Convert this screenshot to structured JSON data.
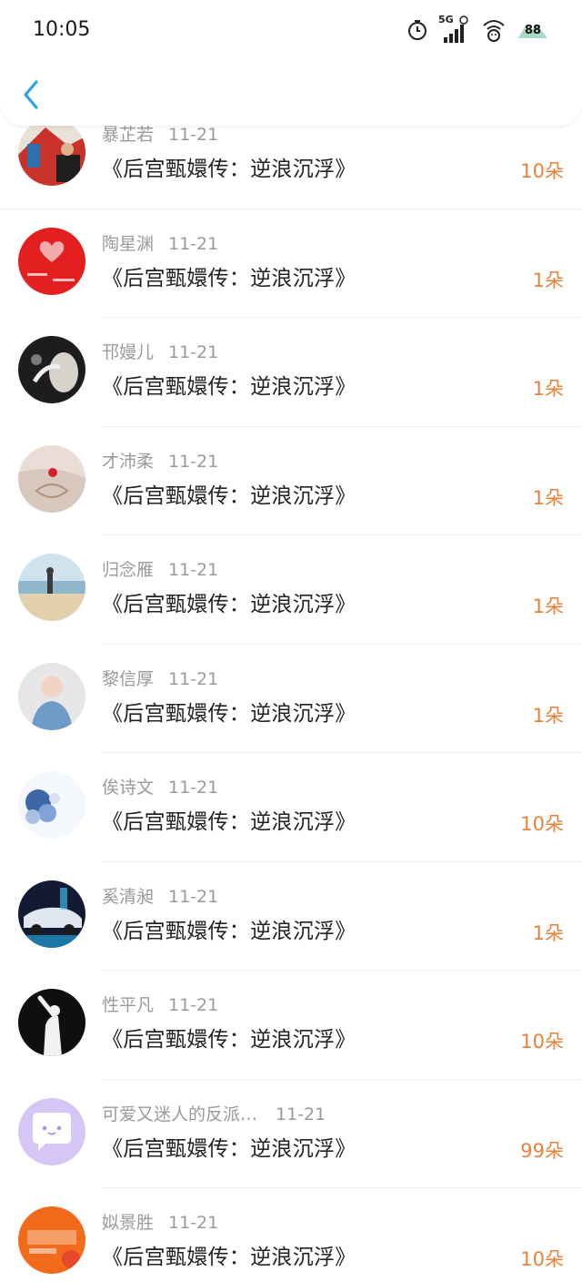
{
  "status_bar": {
    "time": "10:05",
    "network": "5G",
    "battery": "88",
    "icons": [
      "timer-icon",
      "signal-5g-icon",
      "wifi-icon",
      "battery-icon"
    ]
  },
  "nav": {
    "back_icon": "chevron-left-icon",
    "accent": "#2aa3e8"
  },
  "colors": {
    "amount": "#e8823a",
    "name": "#9a9a9a",
    "title": "#222222",
    "separator": "#ededed"
  },
  "list": [
    {
      "name": "暴芷若",
      "date": "11-21",
      "title": "《后宫甄嬛传：逆浪沉浮》",
      "amount": "10朵"
    },
    {
      "name": "陶星渊",
      "date": "11-21",
      "title": "《后宫甄嬛传：逆浪沉浮》",
      "amount": "1朵"
    },
    {
      "name": "邗嫚儿",
      "date": "11-21",
      "title": "《后宫甄嬛传：逆浪沉浮》",
      "amount": "1朵"
    },
    {
      "name": "才沛柔",
      "date": "11-21",
      "title": "《后宫甄嬛传：逆浪沉浮》",
      "amount": "1朵"
    },
    {
      "name": "归念雁",
      "date": "11-21",
      "title": "《后宫甄嬛传：逆浪沉浮》",
      "amount": "1朵"
    },
    {
      "name": "黎信厚",
      "date": "11-21",
      "title": "《后宫甄嬛传：逆浪沉浮》",
      "amount": "1朵"
    },
    {
      "name": "俟诗文",
      "date": "11-21",
      "title": "《后宫甄嬛传：逆浪沉浮》",
      "amount": "10朵"
    },
    {
      "name": "奚清昶",
      "date": "11-21",
      "title": "《后宫甄嬛传：逆浪沉浮》",
      "amount": "1朵"
    },
    {
      "name": "性平凡",
      "date": "11-21",
      "title": "《后宫甄嬛传：逆浪沉浮》",
      "amount": "10朵"
    },
    {
      "name": "可爱又迷人的反派…",
      "date": "11-21",
      "title": "《后宫甄嬛传：逆浪沉浮》",
      "amount": "99朵"
    },
    {
      "name": "姒景胜",
      "date": "11-21",
      "title": "《后宫甄嬛传：逆浪沉浮》",
      "amount": "10朵"
    }
  ]
}
